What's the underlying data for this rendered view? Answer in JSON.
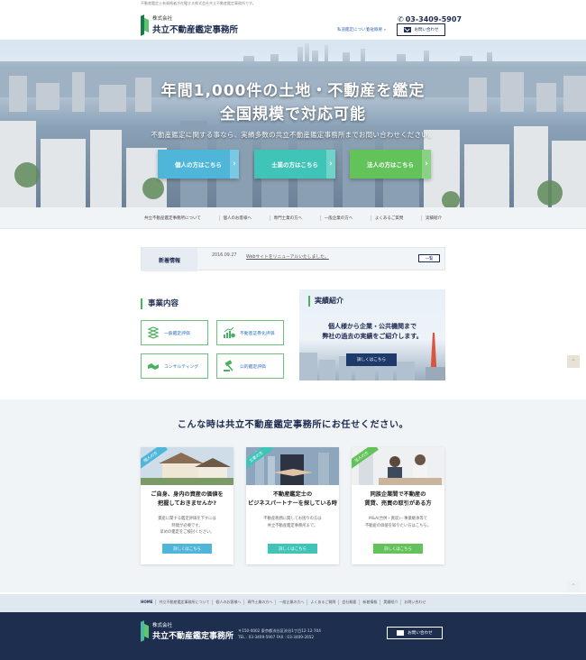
{
  "header": {
    "tagline": "不動産鑑定士有資格者が在籍する株式会社共立不動産鑑定事務所です。",
    "logo_small": "株式会社",
    "logo_main": "共立不動産鑑定事務所",
    "phone": "03-3409-5907",
    "links": [
      "私道鑑定について",
      "会社概要"
    ],
    "contact_label": "お問い合わせ"
  },
  "hero": {
    "title_line1": "年間1,000件の土地・不動産を鑑定",
    "title_line2": "全国規模で対応可能",
    "subtitle": "不動産鑑定に関する事なら、実績多数の共立不動産鑑定事務所までお問い合わせください。",
    "buttons": [
      {
        "label": "個人の方はこちら",
        "color": "#4fb6d9"
      },
      {
        "label": "士業の方はこちら",
        "color": "#3fc4b7"
      },
      {
        "label": "法人の方はこちら",
        "color": "#63c35a"
      }
    ]
  },
  "nav": {
    "items": [
      "共立不動産鑑定事務所について",
      "個人のお客様へ",
      "専門士業の方へ",
      "一般企業の方へ",
      "よくあるご質問",
      "実績紹介"
    ]
  },
  "news": {
    "title": "新着情報",
    "date": "2016.09.27",
    "text": "Webサイトをリニューアルいたしました。",
    "more_label": "一覧"
  },
  "services": {
    "heading": "事業内容",
    "items": [
      {
        "label": "一般鑑定評価",
        "icon": "puzzle-icon"
      },
      {
        "label": "不動産証券化評価",
        "icon": "chart-icon"
      },
      {
        "label": "コンサルティング",
        "icon": "handshake-icon"
      },
      {
        "label": "公的鑑定評価",
        "icon": "gavel-icon"
      }
    ]
  },
  "results": {
    "heading": "実績紹介",
    "text_line1": "個人様から企業・公共機関まで",
    "text_line2": "弊社の過去の実績をご紹介します。",
    "button": "詳しくはこちら"
  },
  "section2": {
    "title": "こんな時は共立不動産鑑定事務所にお任せください。",
    "cards": [
      {
        "tag": "個人の方",
        "tag_color": "#4fb6d9",
        "heading_line1": "ご自身、身内の資産の価値を",
        "heading_line2": "把握しておきませんか?",
        "text_line1": "資産に関する鑑定評価を下すには",
        "text_line2": "時間が必要です。",
        "text_line3": "早めの鑑定をご検討ください。",
        "button": "詳しくはこちら",
        "button_color": "#4fb6d9"
      },
      {
        "tag": "士業の方",
        "tag_color": "#3fc4b7",
        "heading_line1": "不動産鑑定士の",
        "heading_line2": "ビジネスパートナーを探している時",
        "text_line1": "不動産税務に関してお困りの方は",
        "text_line2": "共立不動産鑑定事務所まで。",
        "text_line3": "",
        "button": "詳しくはこちら",
        "button_color": "#3fc4b7"
      },
      {
        "tag": "法人の方",
        "tag_color": "#63c35a",
        "heading_line1": "同族企業間で不動産の",
        "heading_line2": "賃貸、売買の取引がある方",
        "text_line1": "M&A(合併・買収)・事業継承等で",
        "text_line2": "不動産の価値を知りたい方はこちら。",
        "text_line3": "",
        "button": "詳しくはこちら",
        "button_color": "#63c35a"
      }
    ]
  },
  "footer_nav": {
    "items": [
      "HOME",
      "共立不動産鑑定事務所について",
      "個人のお客様へ",
      "専門士業の方へ",
      "一般企業の方へ",
      "よくあるご質問",
      "会社概要",
      "新着情報",
      "実績紹介",
      "お問い合わせ"
    ]
  },
  "footer": {
    "logo_small": "株式会社",
    "logo_main": "共立不動産鑑定事務所",
    "address": "〒150-0002 東京都渋谷区渋谷1丁目12-12-704",
    "tel": "TEL : 03-3409-5907 FAX : 03-3409-2652",
    "contact_label": "お問い合わせ"
  }
}
